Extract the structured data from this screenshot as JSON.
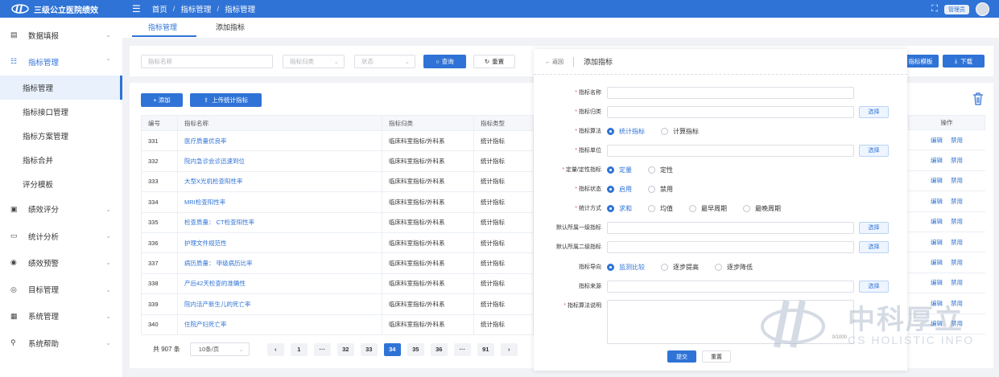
{
  "app": {
    "title": "三级公立医院绩效",
    "user_badge": "管理员"
  },
  "breadcrumb": [
    "首页",
    "指标管理",
    "指标管理"
  ],
  "sidebar": {
    "items": [
      {
        "label": "数据填报",
        "icon": "list-icon"
      },
      {
        "label": "指标管理",
        "icon": "menu-icon",
        "expanded": true,
        "children": [
          "指标管理",
          "指标接口管理",
          "指标方案管理",
          "指标合并",
          "评分模板"
        ]
      },
      {
        "label": "绩效评分",
        "icon": "box-icon"
      },
      {
        "label": "统计分析",
        "icon": "monitor-icon"
      },
      {
        "label": "绩效预警",
        "icon": "eye-icon"
      },
      {
        "label": "目标管理",
        "icon": "target-icon"
      },
      {
        "label": "系统管理",
        "icon": "windows-icon"
      },
      {
        "label": "系统帮助",
        "icon": "search-icon"
      }
    ]
  },
  "tabs": [
    "指标管理",
    "添加指标"
  ],
  "filter": {
    "name_placeholder": "指标名称",
    "category_placeholder": "指标归类",
    "status_placeholder": "状态",
    "query": "查询",
    "reset": "重置"
  },
  "toolbar": {
    "add": "+ 添加",
    "upload": "上传统计指标",
    "template": "指标模板",
    "download": "下载"
  },
  "table": {
    "headers": [
      "编号",
      "指标名称",
      "指标归类",
      "指标类型"
    ],
    "ops_header": "操作",
    "edit": "编辑",
    "disable": "禁用",
    "rows": [
      {
        "id": "331",
        "name": "医疗质量优良率",
        "cat": "临床科室指标/外科系",
        "type": "统计指标"
      },
      {
        "id": "332",
        "name": "院内急诊会诊迅速到位",
        "cat": "临床科室指标/外科系",
        "type": "统计指标"
      },
      {
        "id": "333",
        "name": "大型X光机检查阳性率",
        "cat": "临床科室指标/外科系",
        "type": "统计指标"
      },
      {
        "id": "334",
        "name": "MRI检查阳性率",
        "cat": "临床科室指标/外科系",
        "type": "统计指标"
      },
      {
        "id": "335",
        "name": "检查质量： CT检查阳性率",
        "cat": "临床科室指标/外科系",
        "type": "统计指标"
      },
      {
        "id": "336",
        "name": "护理文件规范性",
        "cat": "临床科室指标/外科系",
        "type": "统计指标"
      },
      {
        "id": "337",
        "name": "病历质量： 甲级病历比率",
        "cat": "临床科室指标/外科系",
        "type": "统计指标"
      },
      {
        "id": "338",
        "name": "产后42天检查的准确性",
        "cat": "临床科室指标/外科系",
        "type": "统计指标"
      },
      {
        "id": "339",
        "name": "院内活产新生儿的死亡率",
        "cat": "临床科室指标/外科系",
        "type": "统计指标"
      },
      {
        "id": "340",
        "name": "住院产妇死亡率",
        "cat": "临床科室指标/外科系",
        "type": "统计指标"
      }
    ]
  },
  "pager": {
    "total": "共 907 条",
    "size": "10条/页",
    "pages": [
      "1",
      "···",
      "32",
      "33",
      "34",
      "35",
      "36",
      "···",
      "91"
    ],
    "current": "34"
  },
  "drawer": {
    "back": "返回",
    "title": "添加指标",
    "labels": {
      "name": "指标名称",
      "category": "指标归类",
      "algo": "指标算法",
      "unit": "指标单位",
      "quant": "定量/定性指标",
      "status": "指标状态",
      "stat": "统计方式",
      "lvl1": "默认所属一级指标",
      "lvl2": "默认所属二级指标",
      "dir": "指标导向",
      "source": "指标来源",
      "desc": "指标算法说明"
    },
    "select": "选择",
    "algo_opts": [
      "统计指标",
      "计算指标"
    ],
    "quant_opts": [
      "定量",
      "定性"
    ],
    "status_opts": [
      "启用",
      "禁用"
    ],
    "stat_opts": [
      "求和",
      "均值",
      "最早周期",
      "最晚周期"
    ],
    "dir_opts": [
      "监测比较",
      "逐步提高",
      "逐步降低"
    ],
    "counter": "0/1000",
    "submit": "提交",
    "reset": "重置"
  },
  "watermark": {
    "cn": "中科厚立",
    "en": "CS HOLISTIC INFO"
  }
}
